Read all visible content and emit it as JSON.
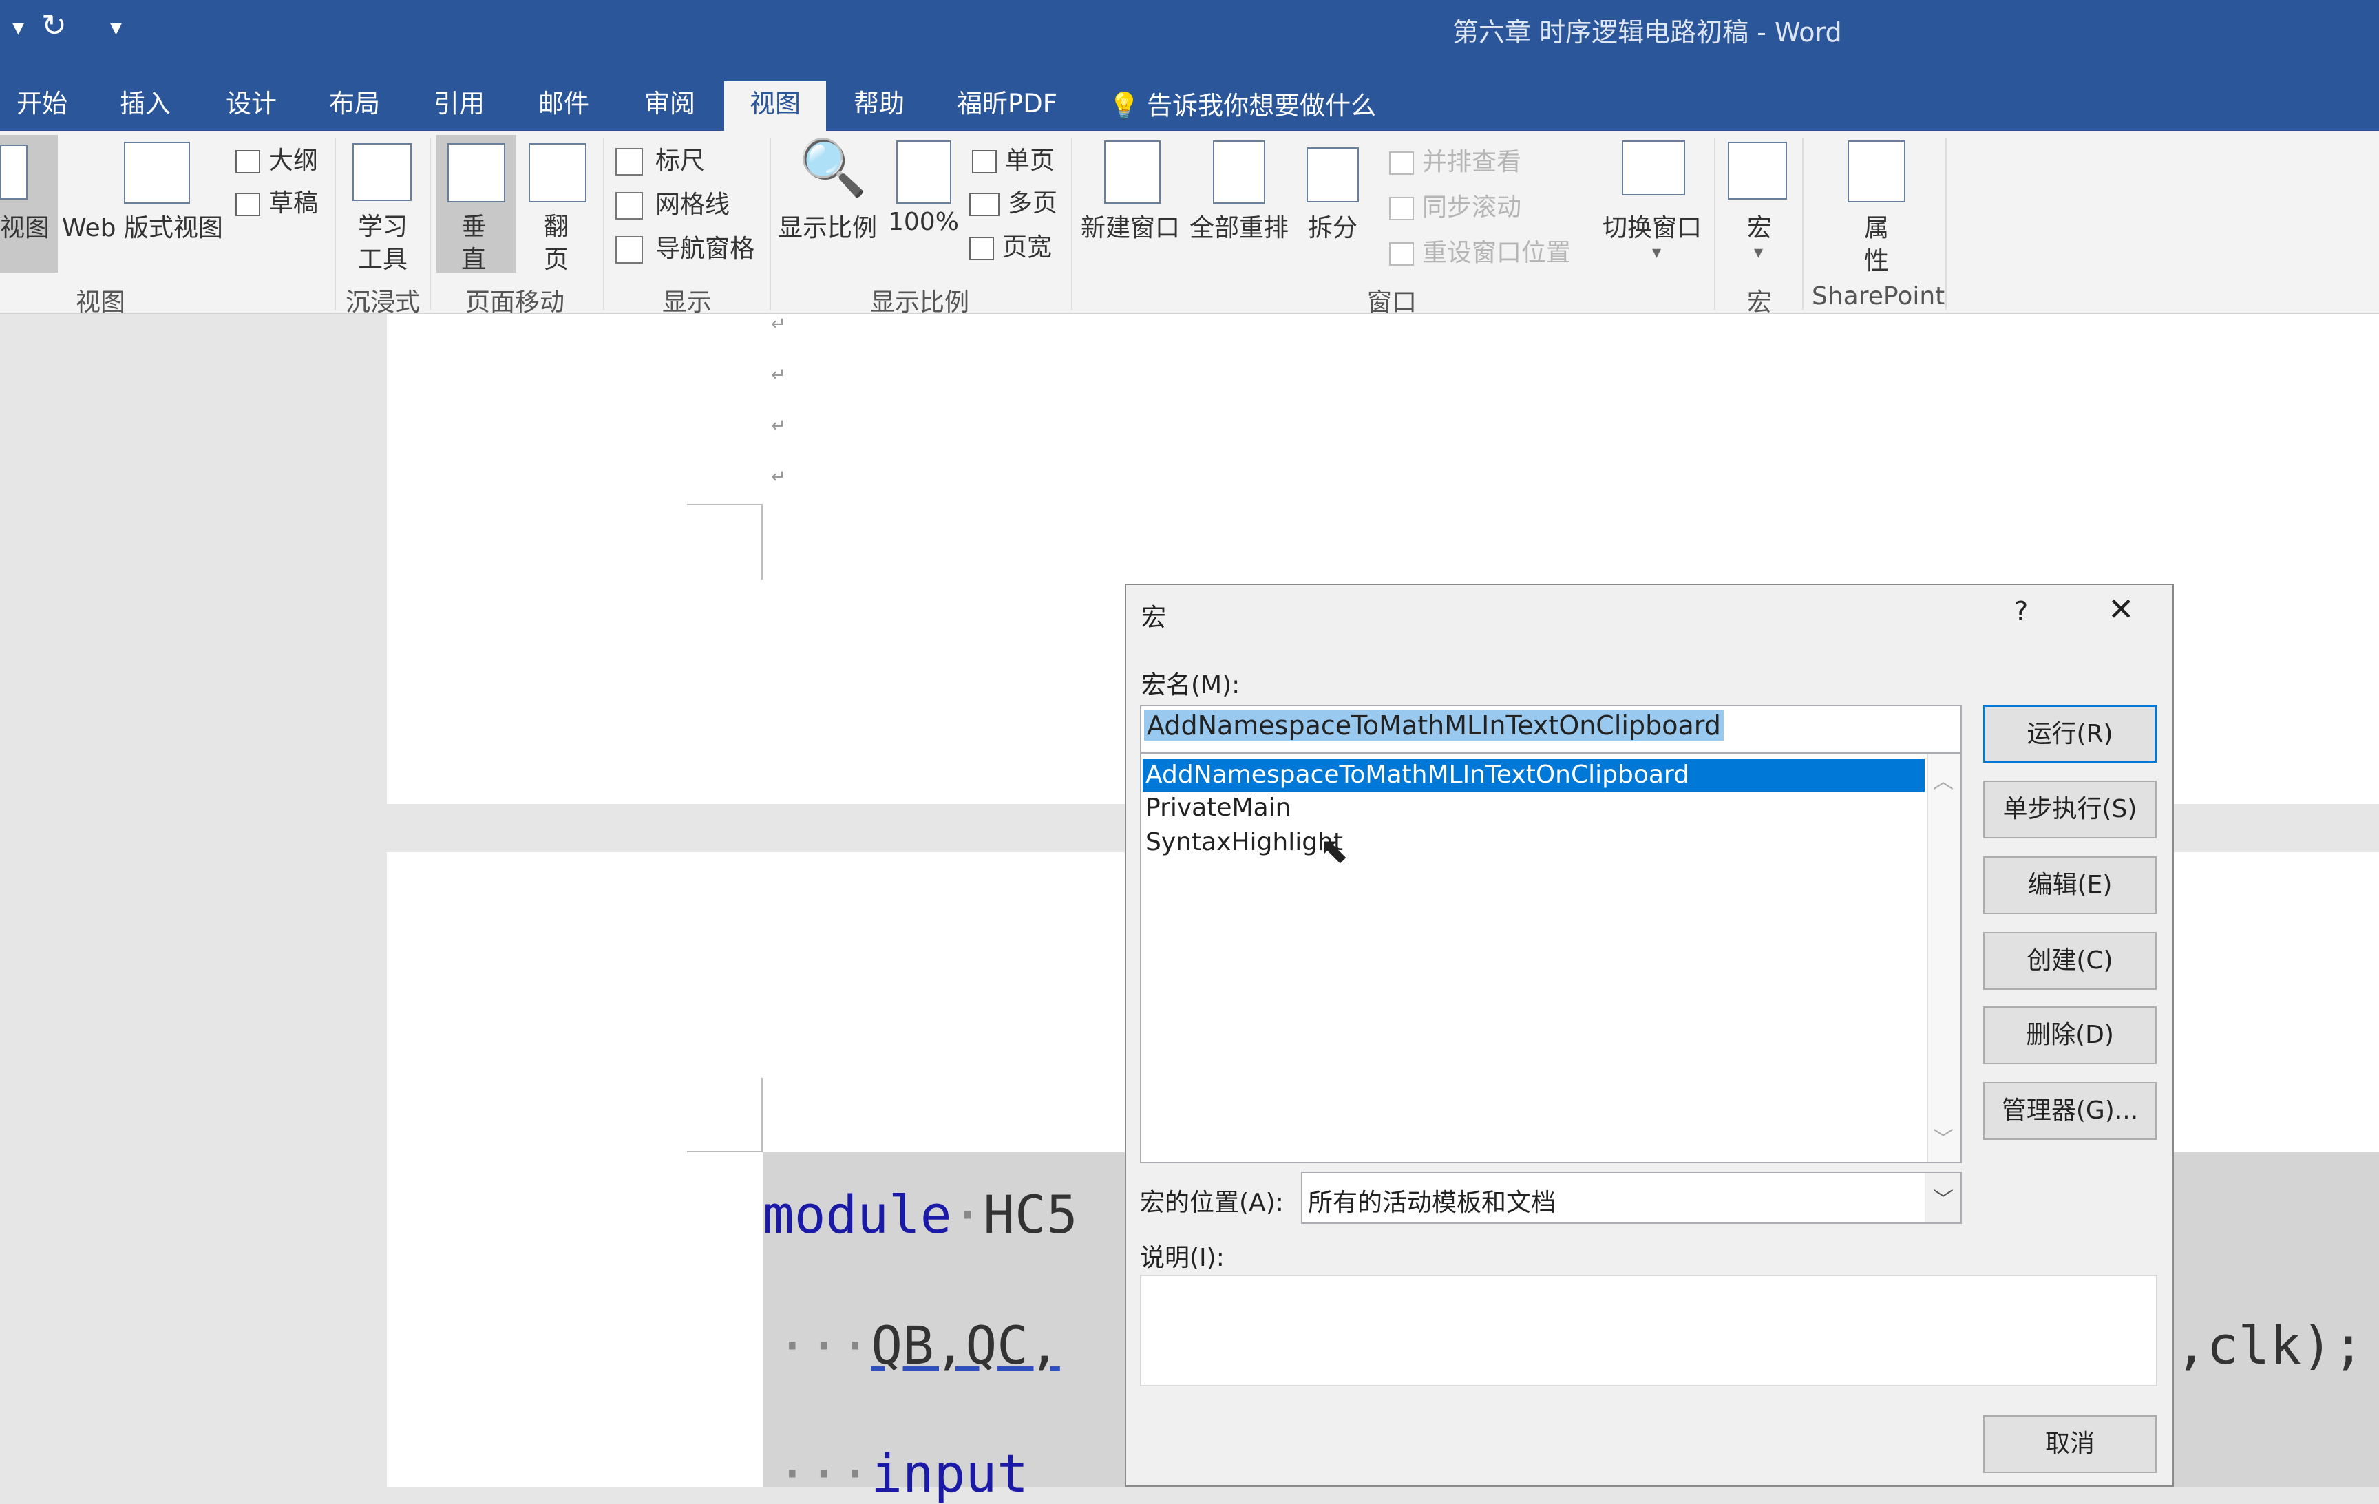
{
  "title": {
    "document": "第六章 时序逻辑电路初稿 - Word"
  },
  "tabs": [
    "开始",
    "插入",
    "设计",
    "布局",
    "引用",
    "邮件",
    "审阅",
    "视图",
    "帮助",
    "福昕PDF"
  ],
  "tell_me": "告诉我你想要做什么",
  "ribbon": {
    "views": {
      "read": "视图",
      "web": "Web 版式视图",
      "outline": "大纲",
      "draft": "草稿",
      "group": "视图"
    },
    "immersive": {
      "learn": [
        "学习",
        "工具"
      ],
      "group": "沉浸式"
    },
    "page_move": {
      "vertical": [
        "垂",
        "直"
      ],
      "flip": [
        "翻",
        "页"
      ],
      "group": "页面移动"
    },
    "show": {
      "ruler": "标尺",
      "gridlines": "网格线",
      "nav_pane": "导航窗格",
      "group": "显示"
    },
    "zoom": {
      "zoom": "显示比例",
      "hundred": "100%",
      "one_page": "单页",
      "multi_page": "多页",
      "page_width": "页宽",
      "group": "显示比例"
    },
    "window": {
      "new_window": "新建窗口",
      "arrange_all": "全部重排",
      "split": "拆分",
      "side_by_side": "并排查看",
      "sync_scroll": "同步滚动",
      "reset_pos": "重设窗口位置",
      "switch": "切换窗口",
      "group": "窗口"
    },
    "macros": {
      "macro": "宏",
      "group": "宏"
    },
    "sharepoint": {
      "props": [
        "属",
        "性"
      ],
      "group": "SharePoint"
    }
  },
  "document": {
    "code_line1_kw": "module",
    "code_line1_rest": "HC5",
    "code_line2": "QB,QC,",
    "code_line2_right": ",clk);",
    "code_line3": "input"
  },
  "dialog": {
    "title": "宏",
    "help": "?",
    "macro_name_label": "宏名(M):",
    "macro_name_value": "AddNamespaceToMathMLInTextOnClipboard",
    "macros": [
      "AddNamespaceToMathMLInTextOnClipboard",
      "PrivateMain",
      "SyntaxHighlight"
    ],
    "buttons": {
      "run": "运行(R)",
      "step": "单步执行(S)",
      "edit": "编辑(E)",
      "create": "创建(C)",
      "delete": "删除(D)",
      "organizer": "管理器(G)...",
      "cancel": "取消"
    },
    "location_label": "宏的位置(A):",
    "location_value": "所有的活动模板和文档",
    "description_label": "说明(I):",
    "description_value": ""
  },
  "colors": {
    "title_bar": "#2b579a",
    "selection": "#0078d7",
    "keyword": "#1a1aa6"
  }
}
